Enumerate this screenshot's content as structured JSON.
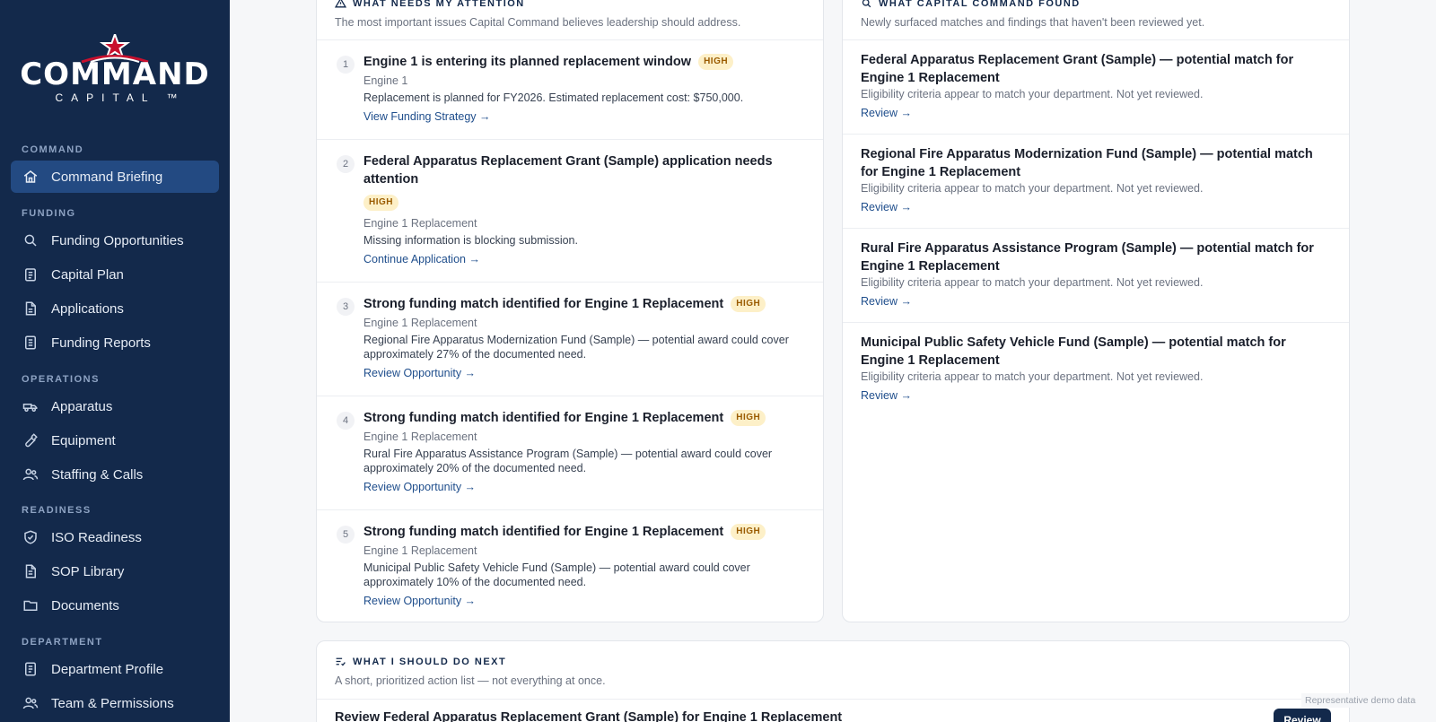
{
  "brand": {
    "word": "COMMAND",
    "sub": "CAPITAL ™"
  },
  "sidebar": {
    "sections": [
      {
        "label": "COMMAND"
      },
      {
        "label": "FUNDING"
      },
      {
        "label": "OPERATIONS"
      },
      {
        "label": "READINESS"
      },
      {
        "label": "DEPARTMENT"
      }
    ],
    "items": [
      {
        "label": "Command Briefing",
        "icon": "home-icon",
        "active": true
      },
      {
        "label": "Funding Opportunities",
        "icon": "search-icon"
      },
      {
        "label": "Capital Plan",
        "icon": "clipboard-icon"
      },
      {
        "label": "Applications",
        "icon": "file-icon"
      },
      {
        "label": "Funding Reports",
        "icon": "report-icon"
      },
      {
        "label": "Apparatus",
        "icon": "truck-icon"
      },
      {
        "label": "Equipment",
        "icon": "wrench-icon"
      },
      {
        "label": "Staffing & Calls",
        "icon": "users-icon"
      },
      {
        "label": "ISO Readiness",
        "icon": "shield-check-icon"
      },
      {
        "label": "SOP Library",
        "icon": "document-icon"
      },
      {
        "label": "Documents",
        "icon": "folder-icon"
      },
      {
        "label": "Department Profile",
        "icon": "profile-doc-icon"
      },
      {
        "label": "Team & Permissions",
        "icon": "team-icon"
      }
    ]
  },
  "attention": {
    "title": "WHAT NEEDS MY ATTENTION",
    "subtitle": "The most important issues Capital Command believes leadership should address.",
    "items": [
      {
        "num": "1",
        "title": "Engine 1 is entering its planned replacement window",
        "badge": "HIGH",
        "sub": "Engine 1",
        "desc": "Replacement is planned for FY2026. Estimated replacement cost: $750,000.",
        "link": "View Funding Strategy →"
      },
      {
        "num": "2",
        "title": "Federal Apparatus Replacement Grant (Sample) application needs attention",
        "badge": "HIGH",
        "sub": "Engine 1 Replacement",
        "desc": "Missing information is blocking submission.",
        "link": "Continue Application →"
      },
      {
        "num": "3",
        "title": "Strong funding match identified for Engine 1 Replacement",
        "badge": "HIGH",
        "sub": "Engine 1 Replacement",
        "desc": "Regional Fire Apparatus Modernization Fund (Sample) — potential award could cover approximately 27% of the documented need.",
        "link": "Review Opportunity →"
      },
      {
        "num": "4",
        "title": "Strong funding match identified for Engine 1 Replacement",
        "badge": "HIGH",
        "sub": "Engine 1 Replacement",
        "desc": "Rural Fire Apparatus Assistance Program (Sample) — potential award could cover approximately 20% of the documented need.",
        "link": "Review Opportunity →"
      },
      {
        "num": "5",
        "title": "Strong funding match identified for Engine 1 Replacement",
        "badge": "HIGH",
        "sub": "Engine 1 Replacement",
        "desc": "Municipal Public Safety Vehicle Fund (Sample) — potential award could cover approximately 10% of the documented need.",
        "link": "Review Opportunity →"
      }
    ]
  },
  "found": {
    "title": "WHAT CAPITAL COMMAND FOUND",
    "subtitle": "Newly surfaced matches and findings that haven't been reviewed yet.",
    "items": [
      {
        "title": "Federal Apparatus Replacement Grant (Sample) — potential match for Engine 1 Replacement",
        "sub": "Eligibility criteria appear to match your department. Not yet reviewed.",
        "link": "Review →"
      },
      {
        "title": "Regional Fire Apparatus Modernization Fund (Sample) — potential match for Engine 1 Replacement",
        "sub": "Eligibility criteria appear to match your department. Not yet reviewed.",
        "link": "Review →"
      },
      {
        "title": "Rural Fire Apparatus Assistance Program (Sample) — potential match for Engine 1 Replacement",
        "sub": "Eligibility criteria appear to match your department. Not yet reviewed.",
        "link": "Review →"
      },
      {
        "title": "Municipal Public Safety Vehicle Fund (Sample) — potential match for Engine 1 Replacement",
        "sub": "Eligibility criteria appear to match your department. Not yet reviewed.",
        "link": "Review →"
      }
    ]
  },
  "next": {
    "title": "WHAT I SHOULD DO NEXT",
    "subtitle": "A short, prioritized action list — not everything at once.",
    "first_item": "Review Federal Apparatus Replacement Grant (Sample) for Engine 1 Replacement",
    "button": "Review"
  },
  "demo_note": "Representative demo data",
  "colors": {
    "sidebar": "#13294b",
    "active": "#234a82",
    "accent": "#1f4e8c",
    "badge_bg": "#fdf0c8",
    "badge_text": "#9a5b00",
    "logo_red": "#c8102e"
  }
}
